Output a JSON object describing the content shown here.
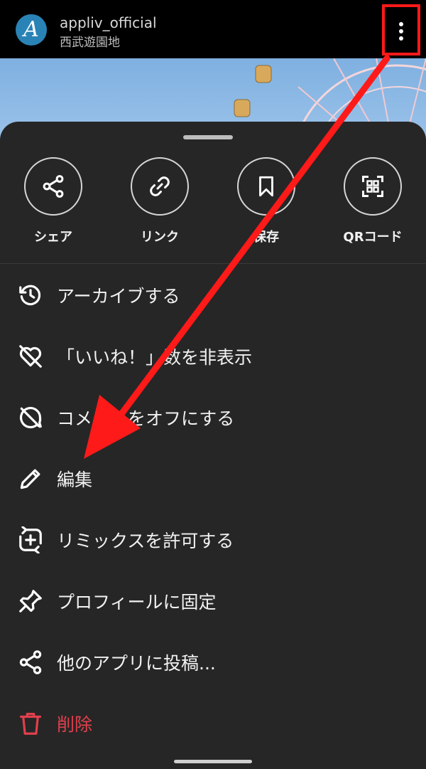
{
  "header": {
    "avatar_letter": "A",
    "username": "appliv_official",
    "location": "西武遊園地",
    "more_icon": "more-vertical-icon"
  },
  "share_actions": [
    {
      "label": "シェア",
      "icon": "share-icon"
    },
    {
      "label": "リンク",
      "icon": "link-icon"
    },
    {
      "label": "保存",
      "icon": "bookmark-icon"
    },
    {
      "label": "QRコード",
      "icon": "qr-code-icon"
    }
  ],
  "menu": [
    {
      "label": "アーカイブする",
      "icon": "archive-history-icon"
    },
    {
      "label": "「いいね！」数を非表示",
      "icon": "heart-off-icon"
    },
    {
      "label": "コメントをオフにする",
      "icon": "comment-off-icon"
    },
    {
      "label": "編集",
      "icon": "pencil-icon"
    },
    {
      "label": "リミックスを許可する",
      "icon": "remix-icon"
    },
    {
      "label": "プロフィールに固定",
      "icon": "pin-icon"
    },
    {
      "label": "他のアプリに投稿...",
      "icon": "share-icon"
    },
    {
      "label": "削除",
      "icon": "trash-icon",
      "color": "#e0404c"
    }
  ],
  "colors": {
    "sheet_bg": "#262626",
    "annotation_red": "#ff1a1a",
    "danger": "#e0404c"
  }
}
